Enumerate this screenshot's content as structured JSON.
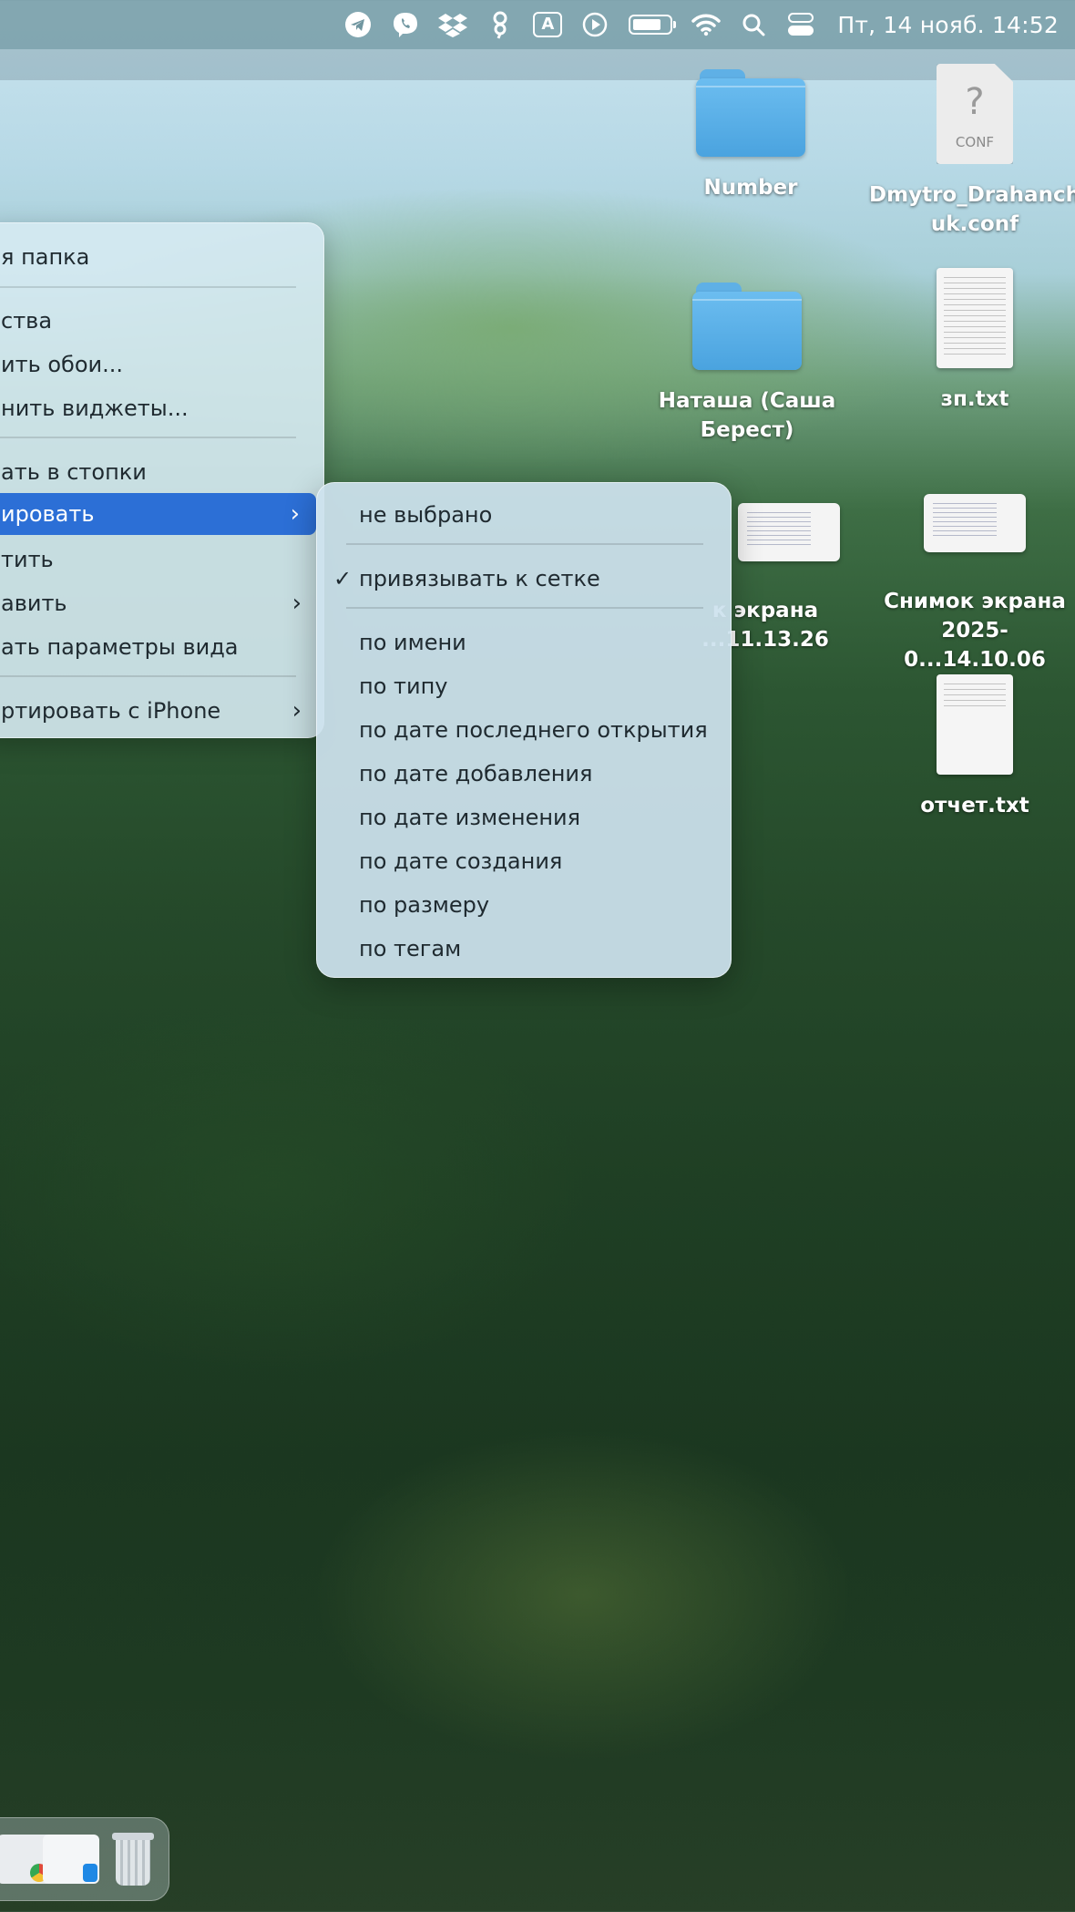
{
  "menubar": {
    "icons": [
      "telegram-icon",
      "viber-icon",
      "dropbox-icon",
      "lasso-icon",
      "input-source-icon",
      "media-play-icon",
      "battery-icon",
      "wifi-icon",
      "spotlight-search-icon",
      "control-center-icon"
    ],
    "input_source_letter": "A",
    "clock": "Пт, 14 нояб.  14:52"
  },
  "desktop_icons": [
    {
      "label": "Number",
      "kind": "folder"
    },
    {
      "label": "Dmytro_Drahanch uk.conf",
      "kind": "conf-file",
      "ext": "CONF"
    },
    {
      "label": "Наташа (Саша Берест)",
      "kind": "folder"
    },
    {
      "label": "зп.txt",
      "kind": "text-file"
    },
    {
      "label": "к экрана ...11.13.26",
      "kind": "screenshot"
    },
    {
      "label": "Снимок экрана 2025-0...14.10.06",
      "kind": "screenshot"
    },
    {
      "label": "отчет.txt",
      "kind": "text-file"
    }
  ],
  "context_menu": {
    "items": [
      {
        "label": "я папка"
      },
      {
        "label": "ства"
      },
      {
        "label": "ить обои..."
      },
      {
        "label": "нить виджеты..."
      },
      {
        "label": "ать в стопки"
      },
      {
        "label": "ировать",
        "submenu": true,
        "highlighted": true
      },
      {
        "label": "тить"
      },
      {
        "label": "авить",
        "submenu": true
      },
      {
        "label": "ать параметры вида"
      },
      {
        "label": "ртировать с iPhone",
        "submenu": true
      }
    ],
    "chevron": "›"
  },
  "sort_submenu": {
    "items": [
      {
        "label": "не выбрано",
        "checked": false
      },
      {
        "label": "привязывать к сетке",
        "checked": true
      },
      {
        "label": "по имени",
        "checked": false
      },
      {
        "label": "по типу",
        "checked": false
      },
      {
        "label": "по дате последнего открытия",
        "checked": false
      },
      {
        "label": "по дате добавления",
        "checked": false
      },
      {
        "label": "по дате изменения",
        "checked": false
      },
      {
        "label": "по дате создания",
        "checked": false
      },
      {
        "label": "по размеру",
        "checked": false
      },
      {
        "label": "по тегам",
        "checked": false
      }
    ],
    "checkmark": "✓"
  },
  "dock": {
    "apps": [
      "chrome-preview-icon",
      "screenshot-preview-icon",
      "trash-icon"
    ]
  },
  "colors": {
    "menu_highlight": "#2c6fd6",
    "folder_blue": "#4aa3df"
  }
}
